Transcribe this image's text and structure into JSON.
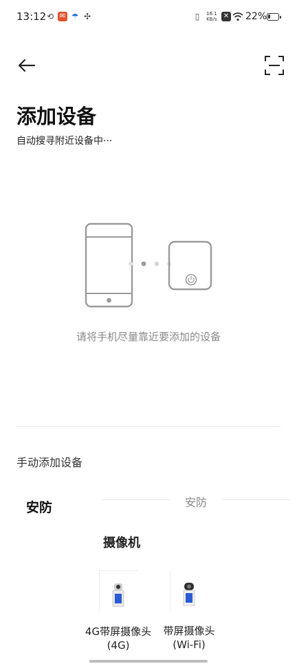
{
  "status_bar": {
    "time": "13:12",
    "net_speed_value": "16.1",
    "net_speed_unit": "KB/s",
    "battery_percent": "22%",
    "battery_level": 0.22
  },
  "header": {
    "title": "添加设备",
    "subtitle": "自动搜寻附近设备中···"
  },
  "illustration": {
    "hint": "请将手机尽量靠近要添加的设备"
  },
  "manual": {
    "label": "手动添加设备",
    "category_selected": "安防",
    "section_title": "安防",
    "subsection_title": "摄像机",
    "products": [
      {
        "name": "4G带屏摄像头(4G)"
      },
      {
        "name": "带屏摄像头(Wi-Fi)"
      }
    ]
  },
  "colors": {
    "accent_text": "#111111",
    "hint_gray": "#8a8a8a",
    "illustration_stroke": "#9a9a9a"
  }
}
